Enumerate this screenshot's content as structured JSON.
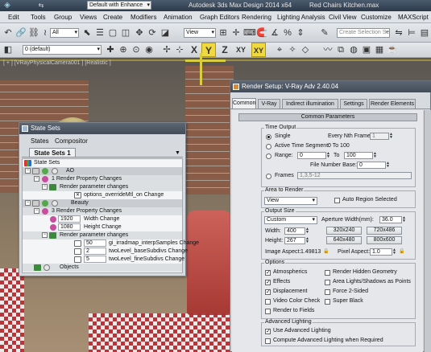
{
  "title_bar": {
    "workspace": "Default with Enhance",
    "app_title": "Autodesk 3ds Max Design 2014 x64",
    "file_name": "Red Chairs Kitchen.max"
  },
  "menu": [
    "Edit",
    "Tools",
    "Group",
    "Views",
    "Create",
    "Modifiers",
    "Animation",
    "Graph Editors",
    "Rendering",
    "Lighting Analysis",
    "Civil View",
    "Customize",
    "MAXScript"
  ],
  "toolbar": {
    "selection_filter": "All",
    "ref_coord": "View",
    "named_selection": "Create Selection Se",
    "layer": "0 (default)",
    "axis_x": "X",
    "axis_y": "Y",
    "axis_z": "Z",
    "axis_xy": "XY",
    "axis_xy2": "XY"
  },
  "viewport": {
    "label": "[ + ] [VRayPhysicalCamera001 ] [Realistic ]"
  },
  "state_sets": {
    "title": "State Sets",
    "menu_states": "States",
    "menu_compositor": "Compositor",
    "tab": "State Sets 1",
    "rows": {
      "root": "State Sets",
      "ao": "AO",
      "ao_rpc": "1 Render Property Changes",
      "ao_rparam": "Render parameter changes",
      "ao_override": "options_overrideMtl_on Change",
      "beauty": "Beauty",
      "beauty_rpc": "3 Render Property Changes",
      "width_val": "1920",
      "width_lbl": "Width Change",
      "height_val": "1080",
      "height_lbl": "Height Change",
      "beauty_rparam": "Render parameter changes",
      "irr_val": "50",
      "irr_lbl": "gi_irradmap_interpSamples Change",
      "base_val": "2",
      "base_lbl": "twoLevel_baseSubdivs Change",
      "fine_val": "5",
      "fine_lbl": "twoLevel_fineSubdivs Change",
      "objects": "Objects"
    }
  },
  "render_setup": {
    "title": "Render Setup: V-Ray Adv 2.40.04",
    "tabs": [
      "Common",
      "V-Ray",
      "Indirect illumination",
      "Settings",
      "Render Elements"
    ],
    "rollout": "Common Parameters",
    "time_output": {
      "label": "Time Output",
      "single": "Single",
      "every_nth": "Every Nth Frame:",
      "every_nth_val": "1",
      "active_segment": "Active Time Segment:",
      "active_range": "0 To 100",
      "range": "Range:",
      "range_from": "0",
      "range_to_lbl": "To",
      "range_to": "100",
      "file_number_base": "File Number Base:",
      "file_number_base_val": "0",
      "frames": "Frames",
      "frames_val": "1,3,5-12"
    },
    "area": {
      "label": "Area to Render",
      "value": "View",
      "auto_region": "Auto Region Selected"
    },
    "output_size": {
      "label": "Output Size",
      "preset": "Custom",
      "aperture": "Aperture Width(mm):",
      "aperture_val": "36.0",
      "width_lbl": "Width:",
      "width_val": "400",
      "height_lbl": "Height:",
      "height_val": "267",
      "p1": "320x240",
      "p2": "720x486",
      "p3": "640x480",
      "p4": "800x600",
      "image_aspect": "Image Aspect:",
      "image_aspect_val": "1.49813",
      "pixel_aspect": "Pixel Aspect:",
      "pixel_aspect_val": "1.0"
    },
    "options": {
      "label": "Options",
      "atmospherics": "Atmospherics",
      "render_hidden": "Render Hidden Geometry",
      "effects": "Effects",
      "area_lights": "Area Lights/Shadows as Points",
      "displacement": "Displacement",
      "force_2sided": "Force 2-Sided",
      "video_color": "Video Color Check",
      "super_black": "Super Black",
      "render_fields": "Render to Fields"
    },
    "adv_lighting": {
      "label": "Advanced Lighting",
      "use": "Use Advanced Lighting",
      "compute": "Compute Advanced Lighting when Required"
    }
  }
}
